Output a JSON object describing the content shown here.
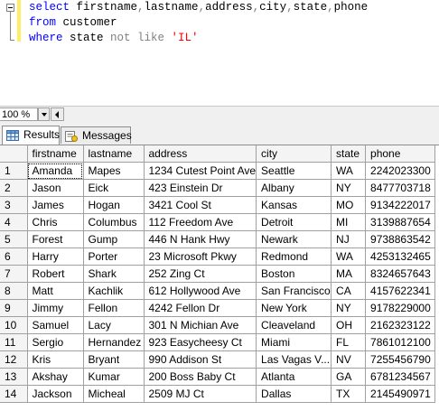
{
  "editor": {
    "line1": {
      "kw": "select",
      "rest": " firstname",
      "c1": ",",
      "f2": "lastname",
      "c2": ",",
      "f3": "address",
      "c3": ",",
      "f4": "city",
      "c4": ",",
      "f5": "state",
      "c5": ",",
      "f6": "phone"
    },
    "line2": {
      "kw": "from",
      "rest": " customer"
    },
    "line3": {
      "kw": "where",
      "field": " state ",
      "op": "not like",
      "str": " 'IL'"
    }
  },
  "zoom": {
    "value": "100 %"
  },
  "tabs": [
    {
      "label": "Results",
      "icon": "grid-icon",
      "active": true
    },
    {
      "label": "Messages",
      "icon": "messages-icon",
      "active": false
    }
  ],
  "results": {
    "columns": [
      "firstname",
      "lastname",
      "address",
      "city",
      "state",
      "phone"
    ],
    "rows": [
      [
        "1",
        "Amanda",
        "Mapes",
        "1234 Cutest Point Ave",
        "Seattle",
        "WA",
        "2242023300"
      ],
      [
        "2",
        "Jason",
        "Eick",
        "423 Einstein Dr",
        "Albany",
        "NY",
        "8477703718"
      ],
      [
        "3",
        "James",
        "Hogan",
        "3421 Cool St",
        "Kansas",
        "MO",
        "9134222017"
      ],
      [
        "4",
        "Chris",
        "Columbus",
        "112 Freedom Ave",
        "Detroit",
        "MI",
        "3139887654"
      ],
      [
        "5",
        "Forest",
        "Gump",
        "446 N Hank Hwy",
        "Newark",
        "NJ",
        "9738863542"
      ],
      [
        "6",
        "Harry",
        "Porter",
        "23 Microsoft Pkwy",
        "Redmond",
        "WA",
        "4253132465"
      ],
      [
        "7",
        "Robert",
        "Shark",
        "252 Zing Ct",
        "Boston",
        "MA",
        "8324657643"
      ],
      [
        "8",
        "Matt",
        "Kachlik",
        "612 Hollywood Ave",
        "San Francisco",
        "CA",
        "4157622341"
      ],
      [
        "9",
        "Jimmy",
        "Fellon",
        "4242 Fellon Dr",
        "New York",
        "NY",
        "9178229000"
      ],
      [
        "10",
        "Samuel",
        "Lacy",
        "301 N Michian Ave",
        "Cleaveland",
        "OH",
        "2162323122"
      ],
      [
        "11",
        "Sergio",
        "Hernandez",
        "923 Easycheesy Ct",
        "Miami",
        "FL",
        "7861012100"
      ],
      [
        "12",
        "Kris",
        "Bryant",
        "990 Addison St",
        "Las Vagas V...",
        "NV",
        "7255456790"
      ],
      [
        "13",
        "Akshay",
        "Kumar",
        "200 Boss Baby Ct",
        "Atlanta",
        "GA",
        "6781234567"
      ],
      [
        "14",
        "Jackson",
        "Micheal",
        "2509 MJ Ct",
        "Dallas",
        "TX",
        "2145490971"
      ]
    ]
  }
}
